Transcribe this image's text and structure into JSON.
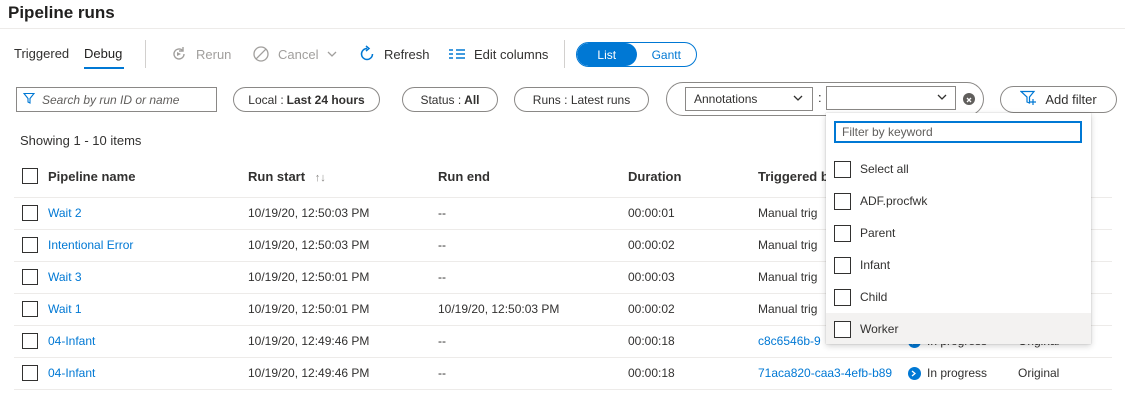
{
  "page": {
    "title": "Pipeline runs"
  },
  "toolbar": {
    "tabs": [
      "Triggered",
      "Debug"
    ],
    "rerun": "Rerun",
    "cancel": "Cancel",
    "refresh": "Refresh",
    "edit_columns": "Edit columns",
    "view_toggle": [
      "List",
      "Gantt"
    ]
  },
  "filters": {
    "search_placeholder": "Search by run ID or name",
    "local": {
      "key": "Local",
      "value": "Last 24 hours"
    },
    "status": {
      "key": "Status",
      "value": "All"
    },
    "runs": {
      "key": "Runs",
      "value": "Latest runs"
    },
    "annotations_select": "Annotations",
    "colon": ":",
    "add_filter": "Add filter"
  },
  "summary": "Showing 1 - 10 items",
  "table": {
    "headers": [
      "Pipeline name",
      "Run start",
      "Run end",
      "Duration",
      "Triggered b"
    ],
    "rows": [
      {
        "name": "Wait 2",
        "start": "10/19/20, 12:50:03 PM",
        "end": "--",
        "duration": "00:00:01",
        "triggered": "Manual trig"
      },
      {
        "name": "Intentional Error",
        "start": "10/19/20, 12:50:03 PM",
        "end": "--",
        "duration": "00:00:02",
        "triggered": "Manual trig"
      },
      {
        "name": "Wait 3",
        "start": "10/19/20, 12:50:01 PM",
        "end": "--",
        "duration": "00:00:03",
        "triggered": "Manual trig"
      },
      {
        "name": "Wait 1",
        "start": "10/19/20, 12:50:01 PM",
        "end": "10/19/20, 12:50:03 PM",
        "duration": "00:00:02",
        "triggered": "Manual trig"
      },
      {
        "name": "04-Infant",
        "start": "10/19/20, 12:49:46 PM",
        "end": "--",
        "duration": "00:00:18",
        "triggered": "c8c6546b-9",
        "status": "In progress",
        "type": "Original"
      },
      {
        "name": "04-Infant",
        "start": "10/19/20, 12:49:46 PM",
        "end": "--",
        "duration": "00:00:18",
        "triggered": "71aca820-caa3-4efb-b89",
        "status": "In progress",
        "type": "Original"
      }
    ]
  },
  "annotation_dropdown": {
    "filter_placeholder": "Filter by keyword",
    "options": [
      "Select all",
      "ADF.procfwk",
      "Parent",
      "Infant",
      "Child",
      "Worker"
    ]
  },
  "colors": {
    "accent": "#0078d4",
    "border": "#8a8886",
    "disabled": "#a19f9d"
  }
}
